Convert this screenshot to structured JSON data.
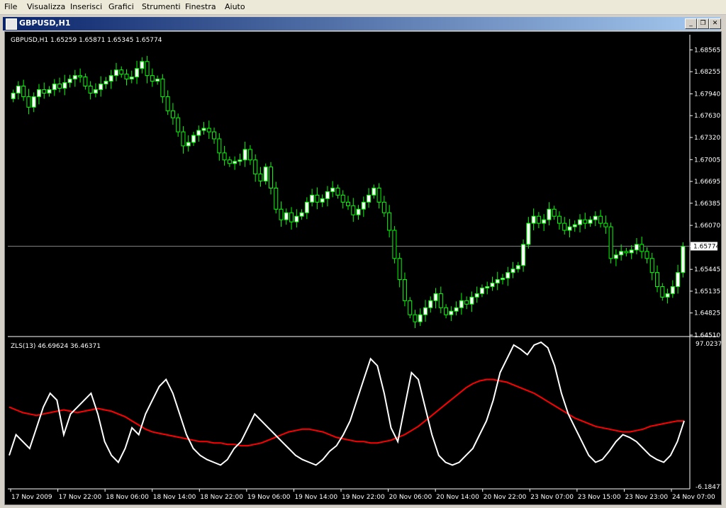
{
  "menu": [
    "File",
    "Visualizza",
    "Inserisci",
    "Grafici",
    "Strumenti",
    "Finestra",
    "Aiuto"
  ],
  "window": {
    "title": "GBPUSD,H1",
    "minimize_icon": "_",
    "restore_icon": "❐",
    "close_icon": "✕"
  },
  "colors": {
    "bull": "#00ff00",
    "bull_fill": "#ffffff",
    "bear": "#00ff00",
    "bear_fill": "#000000",
    "zls": "#ffffff",
    "signal": "#ff0000",
    "axis": "#ffffff",
    "grid_line": "#808080"
  },
  "main_panel": {
    "info": "GBPUSD,H1  1.65259 1.65871 1.65345 1.65774",
    "price_ticks": [
      "1.68565",
      "1.68255",
      "1.67940",
      "1.67630",
      "1.67320",
      "1.67005",
      "1.66695",
      "1.66385",
      "1.66070",
      "1.65774",
      "1.65445",
      "1.65135",
      "1.64825",
      "1.64510"
    ],
    "current_price": "1.65774"
  },
  "indicator_panel": {
    "info": "ZLS(13) 46.69624 36.46371",
    "top_label": "97.02377",
    "bottom_label": "-6.18477"
  },
  "time_labels": [
    "17 Nov 2009",
    "17 Nov 22:00",
    "18 Nov 06:00",
    "18 Nov 14:00",
    "18 Nov 22:00",
    "19 Nov 06:00",
    "19 Nov 14:00",
    "19 Nov 22:00",
    "20 Nov 06:00",
    "20 Nov 14:00",
    "20 Nov 22:00",
    "23 Nov 07:00",
    "23 Nov 15:00",
    "23 Nov 23:00",
    "24 Nov 07:00"
  ],
  "chart_data": {
    "type": "line",
    "price_range": [
      1.6451,
      1.6872
    ],
    "closes": [
      1.6795,
      1.6805,
      1.679,
      1.6775,
      1.679,
      1.68,
      1.6795,
      1.68,
      1.6808,
      1.6802,
      1.681,
      1.6815,
      1.682,
      1.6818,
      1.6805,
      1.6795,
      1.68,
      1.6808,
      1.6812,
      1.682,
      1.6828,
      1.6822,
      1.6815,
      1.6818,
      1.683,
      1.684,
      1.682,
      1.6812,
      1.6815,
      1.679,
      1.677,
      1.676,
      1.674,
      1.672,
      1.6725,
      1.6735,
      1.6742,
      1.6745,
      1.674,
      1.673,
      1.671,
      1.67,
      1.6695,
      1.6698,
      1.67,
      1.6715,
      1.67,
      1.668,
      1.667,
      1.669,
      1.666,
      1.663,
      1.6615,
      1.6625,
      1.6612,
      1.662,
      1.6625,
      1.664,
      1.665,
      1.664,
      1.6645,
      1.6655,
      1.666,
      1.665,
      1.664,
      1.6635,
      1.6622,
      1.663,
      1.664,
      1.665,
      1.666,
      1.664,
      1.6625,
      1.66,
      1.656,
      1.653,
      1.65,
      1.648,
      1.647,
      1.648,
      1.649,
      1.65,
      1.651,
      1.649,
      1.648,
      1.6485,
      1.649,
      1.65,
      1.6495,
      1.6505,
      1.651,
      1.6518,
      1.652,
      1.6525,
      1.653,
      1.6532,
      1.654,
      1.6545,
      1.655,
      1.658,
      1.661,
      1.662,
      1.661,
      1.6615,
      1.663,
      1.662,
      1.661,
      1.66,
      1.6605,
      1.6608,
      1.6615,
      1.661,
      1.6615,
      1.662,
      1.661,
      1.6605,
      1.656,
      1.6565,
      1.657,
      1.6568,
      1.6572,
      1.658,
      1.657,
      1.656,
      1.654,
      1.652,
      1.6505,
      1.651,
      1.652,
      1.654,
      1.6577
    ],
    "zls": [
      15,
      30,
      25,
      20,
      35,
      50,
      60,
      55,
      30,
      45,
      50,
      55,
      60,
      45,
      25,
      15,
      10,
      20,
      35,
      30,
      45,
      55,
      65,
      70,
      60,
      45,
      30,
      20,
      15,
      12,
      10,
      8,
      12,
      20,
      25,
      35,
      45,
      40,
      35,
      30,
      25,
      20,
      15,
      12,
      10,
      8,
      12,
      18,
      22,
      30,
      40,
      55,
      70,
      85,
      80,
      60,
      35,
      25,
      50,
      75,
      70,
      50,
      30,
      15,
      10,
      8,
      10,
      15,
      20,
      30,
      40,
      55,
      75,
      85,
      95,
      92,
      88,
      95,
      97,
      93,
      80,
      60,
      45,
      35,
      25,
      15,
      10,
      12,
      18,
      25,
      30,
      28,
      25,
      20,
      15,
      12,
      10,
      15,
      25,
      40
    ],
    "signal": [
      50,
      48,
      46,
      45,
      44,
      45,
      46,
      47,
      48,
      47,
      46,
      47,
      48,
      49,
      48,
      47,
      45,
      43,
      40,
      37,
      34,
      32,
      31,
      30,
      29,
      28,
      27,
      26,
      25,
      25,
      24,
      24,
      23,
      23,
      22,
      22,
      23,
      24,
      26,
      28,
      30,
      32,
      33,
      34,
      34,
      33,
      32,
      30,
      28,
      27,
      26,
      25,
      25,
      24,
      24,
      25,
      26,
      28,
      30,
      33,
      36,
      40,
      44,
      48,
      52,
      56,
      60,
      64,
      67,
      69,
      70,
      70,
      69,
      68,
      66,
      64,
      62,
      60,
      57,
      54,
      51,
      48,
      45,
      42,
      40,
      38,
      36,
      35,
      34,
      33,
      32,
      32,
      33,
      34,
      36,
      37,
      38,
      39,
      40,
      40
    ]
  }
}
